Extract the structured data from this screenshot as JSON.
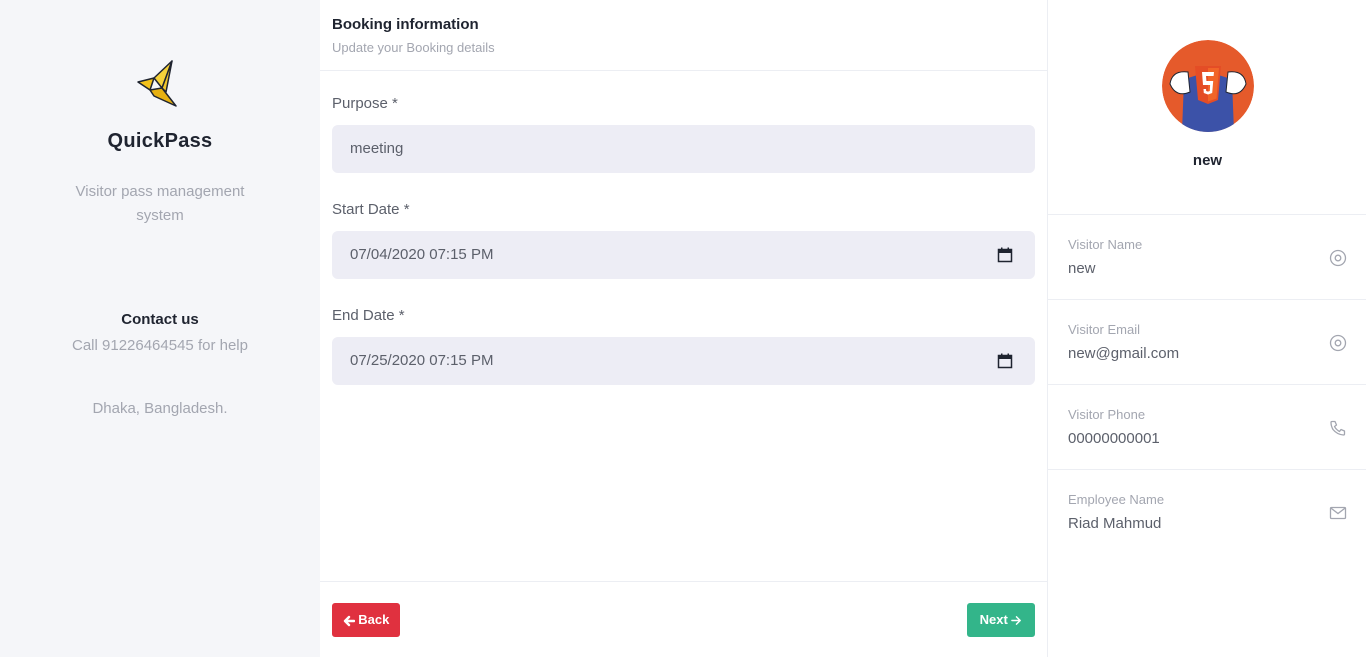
{
  "sidebar": {
    "brand": "QuickPass",
    "tagline": "Visitor pass management system",
    "contact_title": "Contact us",
    "contact_text": "Call 91226464545 for help",
    "address": "Dhaka, Bangladesh."
  },
  "main": {
    "title": "Booking information",
    "subtitle": "Update your Booking details",
    "fields": [
      {
        "label": "Purpose *",
        "value": "meeting"
      },
      {
        "label": "Start Date *",
        "value": "07/04/2020 07:15 PM"
      },
      {
        "label": "End Date *",
        "value": "07/25/2020 07:15 PM"
      }
    ],
    "back_label": "Back",
    "next_label": "Next"
  },
  "profile": {
    "name": "new",
    "items": [
      {
        "label": "Visitor Name",
        "value": "new",
        "icon": "target-icon"
      },
      {
        "label": "Visitor Email",
        "value": "new@gmail.com",
        "icon": "target-icon"
      },
      {
        "label": "Visitor Phone",
        "value": "00000000001",
        "icon": "phone-icon"
      },
      {
        "label": "Employee Name",
        "value": "Riad Mahmud",
        "icon": "mail-icon"
      }
    ]
  },
  "colors": {
    "back": "#e0313f",
    "next": "#33b58a",
    "sidebar_bg": "#f5f6f9",
    "field_bg": "#ededf5"
  }
}
